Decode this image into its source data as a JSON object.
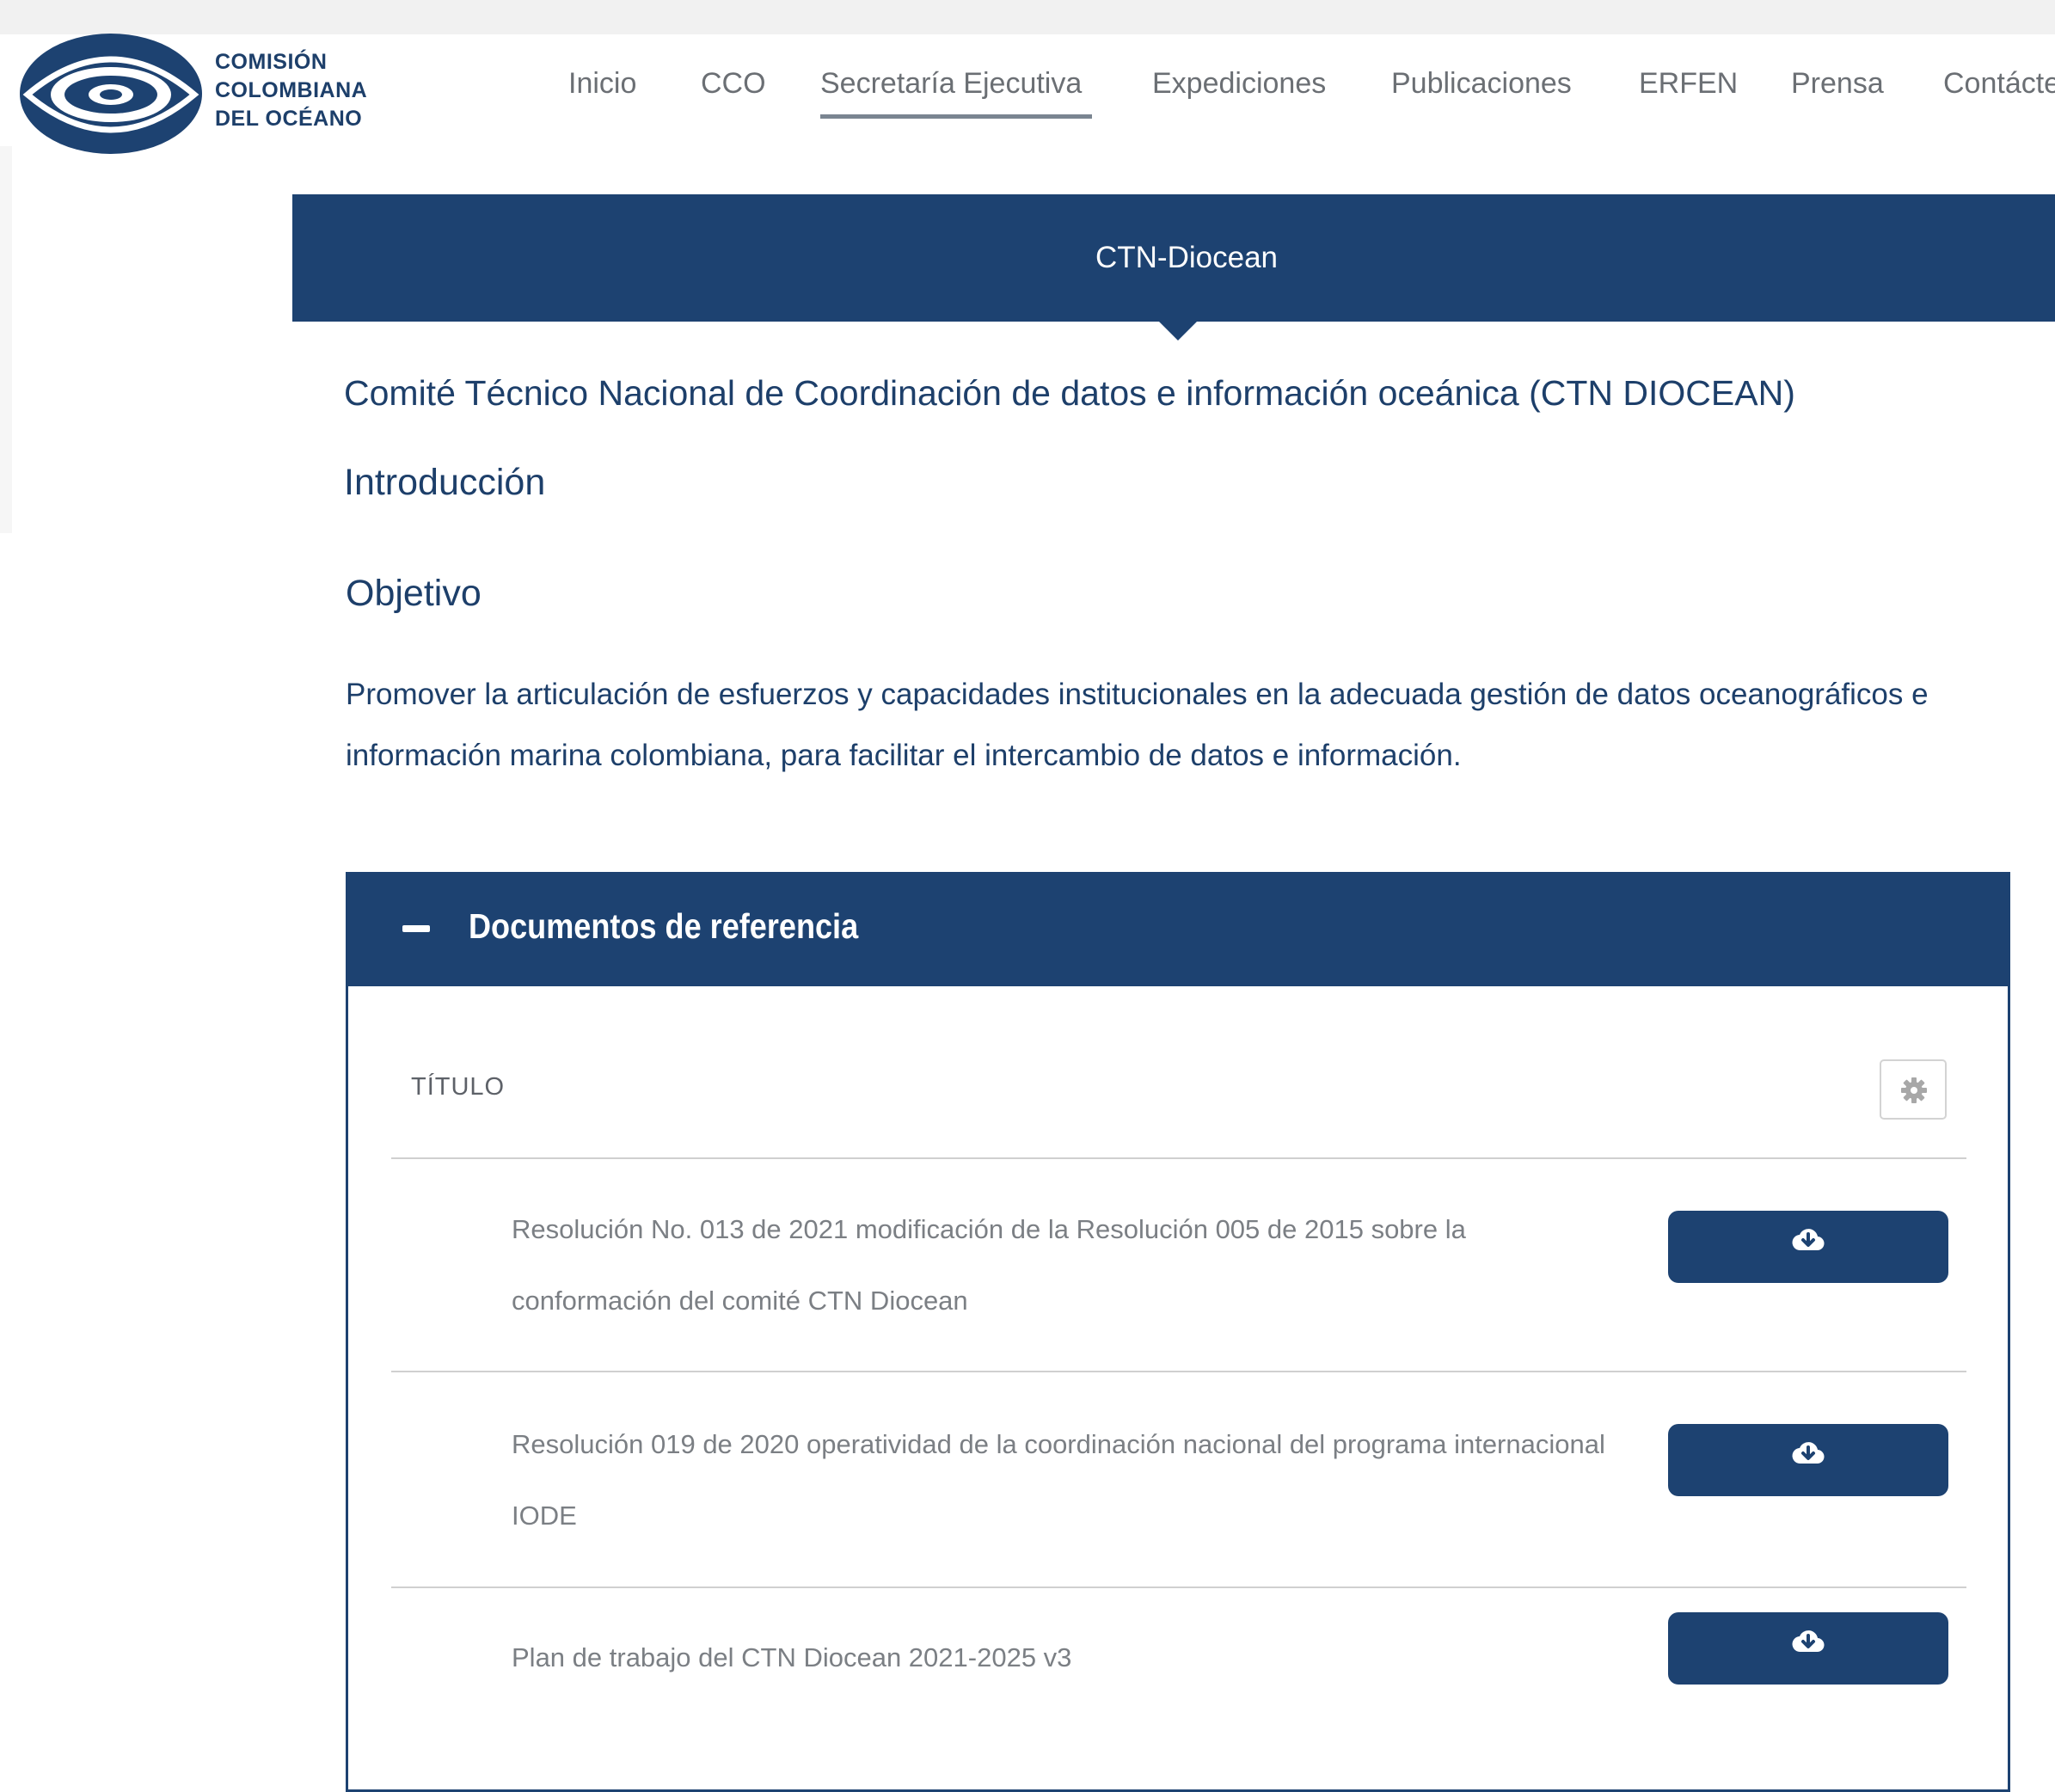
{
  "brand": {
    "logo_lines": [
      "COMISIÓN",
      "COLOMBIANA",
      "DEL OCÉANO"
    ],
    "color_primary": "#1d4271"
  },
  "nav": {
    "items": [
      "Inicio",
      "CCO",
      "Secretaría Ejecutiva",
      "Expediciones",
      "Publicaciones",
      "ERFEN",
      "Prensa",
      "Contácte"
    ],
    "active": "Secretaría Ejecutiva"
  },
  "banner": {
    "title": "CTN-Diocean"
  },
  "content": {
    "main_heading": "Comité Técnico Nacional de Coordinación de datos e información oceánica (CTN DIOCEAN)",
    "intro_heading": "Introducción",
    "objective_heading": "Objetivo",
    "objective_text": "Promover la articulación de esfuerzos y capacidades institucionales en la adecuada gestión de datos oceanográficos e información marina colombiana, para facilitar el intercambio de datos e información."
  },
  "documents": {
    "panel_title": "Documentos de referencia",
    "column_title": "TÍTULO",
    "settings_icon": "gear-icon",
    "download_icon": "cloud-download-icon",
    "rows": [
      "Resolución No. 013 de 2021 modificación de la Resolución 005 de 2015 sobre la conformación del comité CTN Diocean",
      "Resolución 019 de 2020 operatividad de la coordinación nacional del programa internacional IODE",
      "Plan de trabajo del CTN Diocean 2021-2025 v3"
    ]
  }
}
